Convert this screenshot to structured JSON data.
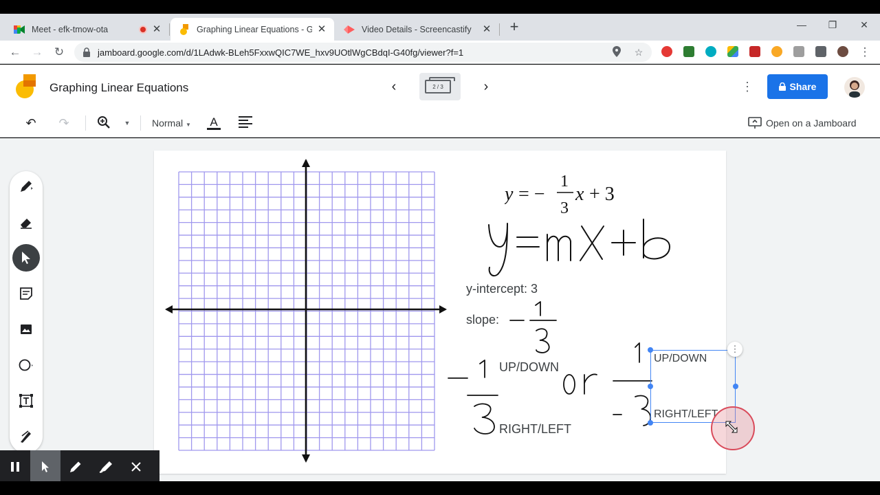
{
  "browser": {
    "tabs": [
      {
        "title": "Meet - efk-tmow-ota",
        "favicon": "meet-icon",
        "recording": true
      },
      {
        "title": "Graphing Linear Equations - Goo",
        "favicon": "jamboard-icon",
        "active": true
      },
      {
        "title": "Video Details - Screencastify",
        "favicon": "screencastify-icon"
      }
    ],
    "new_tab_label": "+",
    "url": "jamboard.google.com/d/1LAdwk-BLeh5FxxwQIC7WE_hxv9UOtlWgCBdqI-G40fg/viewer?f=1"
  },
  "header": {
    "title": "Graphing Linear Equations",
    "frame_counter": "2 / 3",
    "share_label": "Share"
  },
  "toolbar": {
    "style_label": "Normal",
    "open_label": "Open on a Jamboard"
  },
  "board": {
    "equation_printed": "y = −(1/3)x + 3",
    "handwritten_formula": "y=mx+b",
    "y_intercept": "y-intercept: 3",
    "slope_label": "slope:",
    "up_down": "UP/DOWN",
    "right_left": "RIGHT/LEFT",
    "selected_up_down": "UP/DOWN",
    "selected_right_left": "RIGHT/LEFT",
    "handwritten_or": "or",
    "grid": {
      "columns": 20,
      "rows": 22,
      "color": "#9f97ee"
    }
  },
  "colors": {
    "accent": "#1a73e8",
    "selection": "#4285f4",
    "cursor_ring": "#d94a5a"
  }
}
